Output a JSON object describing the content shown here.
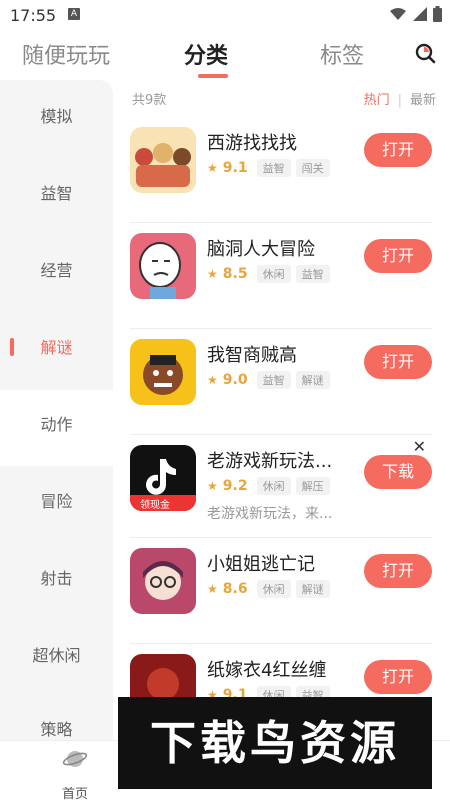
{
  "status": {
    "time": "17:55",
    "notif_icon": "A"
  },
  "tabs": [
    {
      "label": "随便玩玩"
    },
    {
      "label": "分类"
    },
    {
      "label": "标签"
    }
  ],
  "sidebar": {
    "items": [
      {
        "label": "模拟"
      },
      {
        "label": "益智"
      },
      {
        "label": "经营"
      },
      {
        "label": "解谜"
      },
      {
        "label": "动作"
      },
      {
        "label": "冒险"
      },
      {
        "label": "射击"
      },
      {
        "label": "超休闲"
      },
      {
        "label": "策略"
      }
    ]
  },
  "list": {
    "count": "共9款",
    "sort_hot": "热门",
    "sort_sep": "|",
    "sort_new": "最新",
    "games": [
      {
        "name": "西游找找找",
        "score": "9.1",
        "tags": [
          "益智",
          "闯关"
        ],
        "button": "打开"
      },
      {
        "name": "脑洞人大冒险",
        "score": "8.5",
        "tags": [
          "休闲",
          "益智"
        ],
        "button": "打开"
      },
      {
        "name": "我智商贼高",
        "score": "9.0",
        "tags": [
          "益智",
          "解谜"
        ],
        "button": "打开"
      },
      {
        "name": "老游戏新玩法...",
        "score": "9.2",
        "tags": [
          "休闲",
          "解压"
        ],
        "desc": "老游戏新玩法，来...",
        "button": "下载",
        "ad_badge": "领现金"
      },
      {
        "name": "小姐姐逃亡记",
        "score": "8.6",
        "tags": [
          "休闲",
          "解谜"
        ],
        "button": "打开"
      },
      {
        "name": "纸嫁衣4红丝缠",
        "score": "9.1",
        "tags": [
          "休闲",
          "益智"
        ],
        "button": "打开"
      }
    ]
  },
  "bottomnav": {
    "home": "首页"
  },
  "watermark": "下载鸟资源",
  "colors": {
    "accent": "#f56b5f",
    "star": "#e8a53c"
  }
}
